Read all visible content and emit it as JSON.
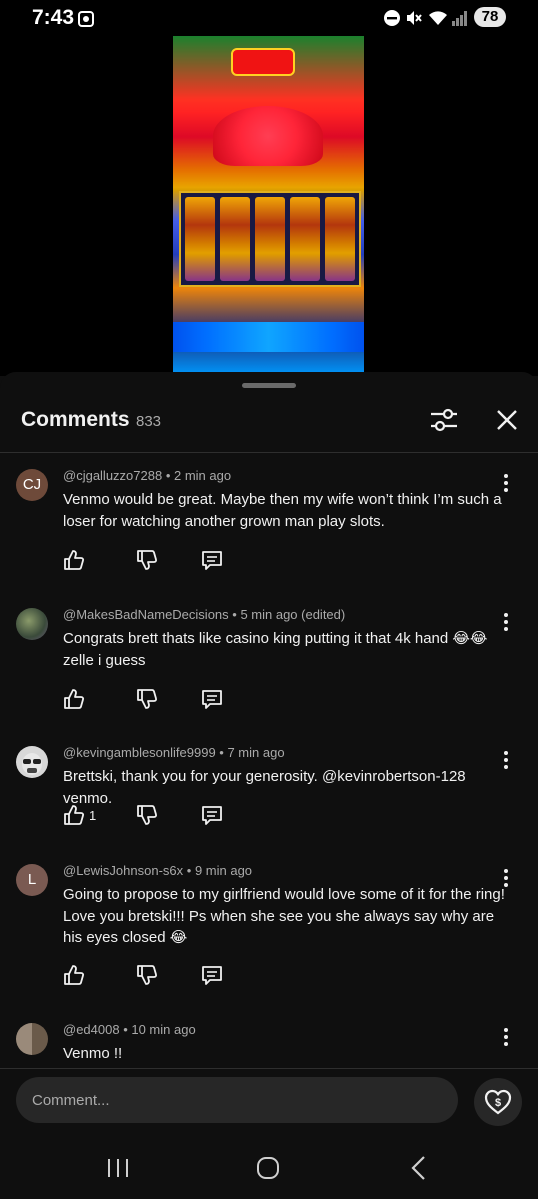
{
  "status_bar": {
    "time": "7:43",
    "battery": "78",
    "icons": [
      "screenshot-icon",
      "dnd-icon",
      "mute-icon",
      "wifi-icon",
      "signal-icon"
    ]
  },
  "video": {
    "description_icon": "slot-machine-video"
  },
  "comments_header": {
    "title": "Comments",
    "count": "833"
  },
  "comments": [
    {
      "avatar_text": "CJ",
      "avatar_color": "#6e4a3a",
      "handle": "@cjgalluzzo7288",
      "time": "2 min ago",
      "text": "Venmo would be great. Maybe then my wife won’t think I’m such a loser for watching another grown man play slots.",
      "likes": ""
    },
    {
      "avatar_text": "",
      "avatar_color": "#4a5a3a",
      "handle": "@MakesBadNameDecisions",
      "time": "5 min ago (edited)",
      "text": "Congrats brett thats like casino king putting it that 4k hand 😂😂 zelle i guess",
      "likes": ""
    },
    {
      "avatar_text": "",
      "avatar_color": "#cfcfcf",
      "handle": "@kevingamblesonlife9999",
      "time": "7 min ago",
      "text": "Brettski, thank you for your generosity. @kevinrobertson-128 venmo.",
      "likes": "1"
    },
    {
      "avatar_text": "L",
      "avatar_color": "#7a5a52",
      "handle": "@LewisJohnson-s6x",
      "time": "9 min ago",
      "text": "Going to propose to my girlfriend would love some of it for the ring! Love you bretski!!! Ps when she see you she always say why are his eyes closed 😂",
      "likes": ""
    },
    {
      "avatar_text": "",
      "avatar_color": "#8a7a6a",
      "handle": "@ed4008",
      "time": "10 min ago",
      "text": "Venmo !!",
      "likes": ""
    }
  ],
  "input": {
    "placeholder": "Comment..."
  },
  "colors": {
    "background": "#0f0f0f",
    "text_primary": "#f1f1f1",
    "text_secondary": "#aaaaaa",
    "input_bg": "#272727"
  }
}
